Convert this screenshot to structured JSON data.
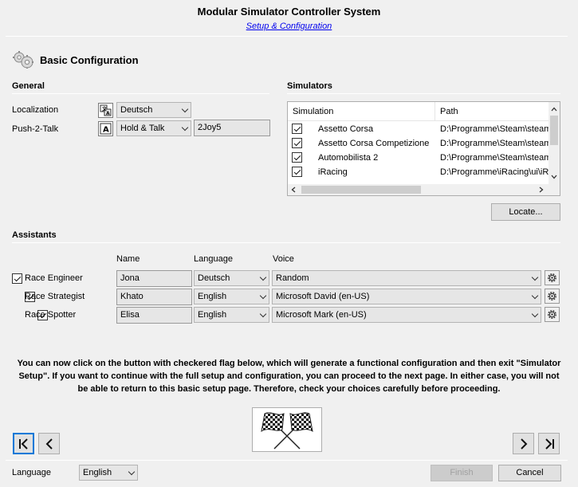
{
  "header": {
    "title": "Modular Simulator Controller System",
    "subtitle": "Setup & Configuration"
  },
  "page": {
    "title": "Basic Configuration",
    "icon": "gears-icon"
  },
  "general": {
    "section_title": "General",
    "localization_label": "Localization",
    "localization_value": "Deutsch",
    "push2talk_label": "Push-2-Talk",
    "push2talk_mode": "Hold & Talk",
    "push2talk_button": "2Joy5"
  },
  "simulators": {
    "section_title": "Simulators",
    "columns": [
      "Simulation",
      "Path"
    ],
    "rows": [
      {
        "name": "Assetto Corsa",
        "path": "D:\\Programme\\Steam\\steamapps",
        "checked": true
      },
      {
        "name": "Assetto Corsa Competizione",
        "path": "D:\\Programme\\Steam\\steamapps",
        "checked": true
      },
      {
        "name": "Automobilista 2",
        "path": "D:\\Programme\\Steam\\steamapps",
        "checked": true
      },
      {
        "name": "iRacing",
        "path": "D:\\Programme\\iRacing\\ui\\iRacingUI.exe",
        "checked": true
      }
    ],
    "locate_button": "Locate..."
  },
  "assistants": {
    "section_title": "Assistants",
    "columns": {
      "name": "Name",
      "language": "Language",
      "voice": "Voice"
    },
    "rows": [
      {
        "role": "Race Engineer",
        "name": "Jona",
        "language": "Deutsch",
        "voice": "Random",
        "checked": true
      },
      {
        "role": "Race Strategist",
        "name": "Khato",
        "language": "English",
        "voice": "Microsoft David (en-US)",
        "checked": true
      },
      {
        "role": "Race Spotter",
        "name": "Elisa",
        "language": "English",
        "voice": "Microsoft Mark (en-US)",
        "checked": true
      }
    ]
  },
  "info_text": "You can now click on the button with checkered flag below, which will generate a functional configuration and then exit \"Simulator Setup\". If you want to continue with the full setup and configuration, you can proceed to the next page. In either case, you will not be able to return to this basic setup page. Therefore, check your choices carefully before proceeding.",
  "footer": {
    "language_label": "Language",
    "language_value": "English",
    "finish_button": "Finish",
    "cancel_button": "Cancel"
  },
  "colors": {
    "link": "#0000ee",
    "focus": "#0078d7",
    "background": "#f0f0f0"
  }
}
